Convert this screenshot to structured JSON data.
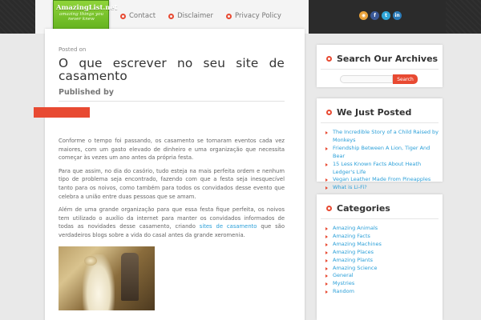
{
  "logo": {
    "title": "AmazingList.net",
    "tagline": "amazing things you never knew"
  },
  "nav": {
    "items": [
      {
        "label": "Contact"
      },
      {
        "label": "Disclaimer"
      },
      {
        "label": "Privacy Policy"
      }
    ]
  },
  "social": {
    "icons": [
      "rss-icon",
      "facebook-icon",
      "twitter-icon",
      "linkedin-icon"
    ],
    "colors": [
      "#e8a23a",
      "#3b5998",
      "#2fa5d6",
      "#2b7bb9"
    ],
    "glyphs": [
      "◉",
      "f",
      "t",
      "in"
    ]
  },
  "post": {
    "posted_on": "Posted on",
    "title": "O que escrever no seu site de casamento",
    "published_by": "Published by",
    "paragraphs": [
      {
        "text": "Conforme o tempo foi passando, os casamento se tornaram eventos cada vez maiores, com um gasto elevado de dinheiro e uma organização que necessita começar às vezes um ano antes da própria festa."
      },
      {
        "text": "Para que assim, no dia do casório, tudo esteja na mais perfeita ordem e nenhum tipo de problema seja encontrado, fazendo com que a festa seja inesquecível tanto para os noivos, como também para todos os convidados desse evento que celebra a união entre duas pessoas que se amam."
      }
    ],
    "para3_before": "Além de uma grande organização para que essa festa fique perfeita, os noivos tem utilizado o auxílio da internet para manter os convidados informados de todas as novidades desse casamento, criando ",
    "para3_link": "sites de casamento",
    "para3_after": " que são verdadeiros blogs sobre a vida do casal antes da grande xeromenia."
  },
  "search_widget": {
    "title": "Search Our Archives",
    "input_value": "",
    "button_label": "Search"
  },
  "recent_widget": {
    "title": "We Just Posted",
    "items": [
      {
        "label": "The Incredible Story of a Child Raised by Monkeys"
      },
      {
        "label": "Friendship Between A Lion, Tiger And Bear"
      },
      {
        "label": "15 Less Known Facts About Heath Ledger's Life"
      },
      {
        "label": "Vegan Leather Made From Pineapples"
      },
      {
        "label": "What is Li-Fi?"
      }
    ]
  },
  "categories_widget": {
    "title": "Categories",
    "items": [
      {
        "label": "Amazing Animals"
      },
      {
        "label": "Amazing Facts"
      },
      {
        "label": "Amazing Machines"
      },
      {
        "label": "Amazing Places"
      },
      {
        "label": "Amazing Plants"
      },
      {
        "label": "Amazing Science"
      },
      {
        "label": "General"
      },
      {
        "label": "Mystries"
      },
      {
        "label": "Random"
      }
    ]
  },
  "colors": {
    "accent": "#e84a32",
    "link": "#2a9fd8",
    "logo_green": "#6cbf23"
  }
}
